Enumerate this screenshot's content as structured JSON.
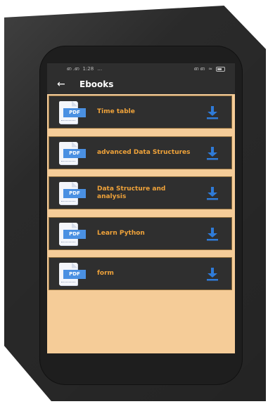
{
  "status_bar": {
    "time": "1:28",
    "signal": "ഩ .ഩ",
    "extra": "…",
    "right_indicators": "ഩ ഩ"
  },
  "app_bar": {
    "title": "Ebooks"
  },
  "items": [
    {
      "label": "Time table",
      "icon": "pdf-file-icon",
      "tag": "PDF"
    },
    {
      "label": "advanced Data Structures",
      "icon": "pdf-file-icon",
      "tag": "PDF"
    },
    {
      "label": "Data Structure and analysis",
      "icon": "pdf-file-icon",
      "tag": "PDF"
    },
    {
      "label": "Learn Python",
      "icon": "pdf-file-icon",
      "tag": "PDF"
    },
    {
      "label": "form",
      "icon": "pdf-file-icon",
      "tag": "PDF"
    }
  ],
  "colors": {
    "accent": "#f0a33a",
    "download": "#2f7bd8",
    "list_background": "#f5cc98",
    "card": "#2f2f2f"
  }
}
